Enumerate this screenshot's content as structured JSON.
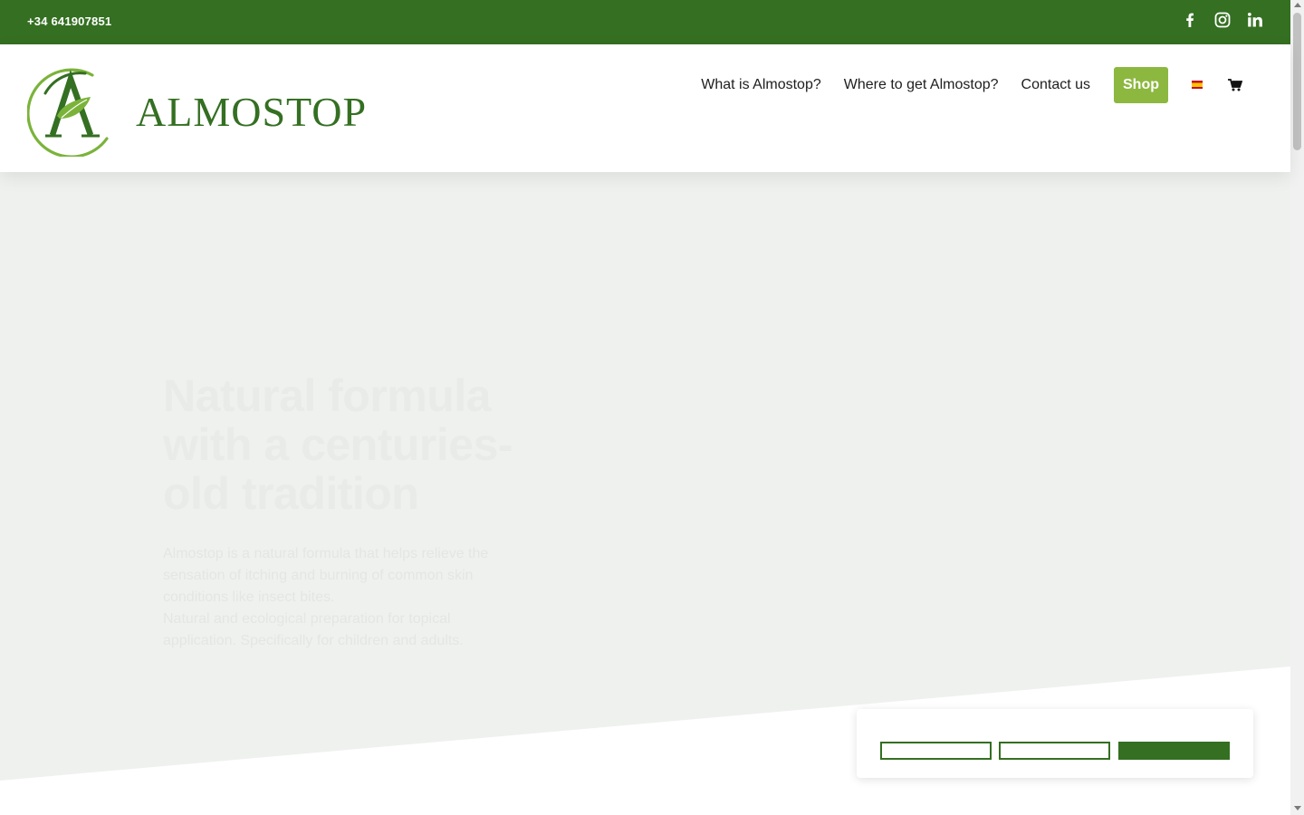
{
  "topbar": {
    "phone": "+34 641907851",
    "social": [
      {
        "name": "facebook-icon"
      },
      {
        "name": "instagram-icon"
      },
      {
        "name": "linkedin-icon"
      }
    ],
    "background_color": "#346f22"
  },
  "header": {
    "brand": "ALMOSTOP",
    "nav": {
      "what_is": "What is Almostop?",
      "where_to_get": "Where to get Almostop?",
      "contact": "Contact us",
      "shop": "Shop"
    },
    "language_flag": "spain-flag-icon",
    "cart_icon": "cart-icon"
  },
  "hero": {
    "title": "Natural formula with a centuries-old tradition",
    "paragraph_1": "Almostop is a natural formula that helps relieve the sensation of itching and burning of common skin conditions like insect bites.",
    "paragraph_2": "Natural and ecological preparation for topical application. Specifically for children and adults."
  },
  "colors": {
    "brand_green": "#346f22",
    "accent_green": "#8cb83f",
    "hero_bg": "#eff1ef"
  }
}
